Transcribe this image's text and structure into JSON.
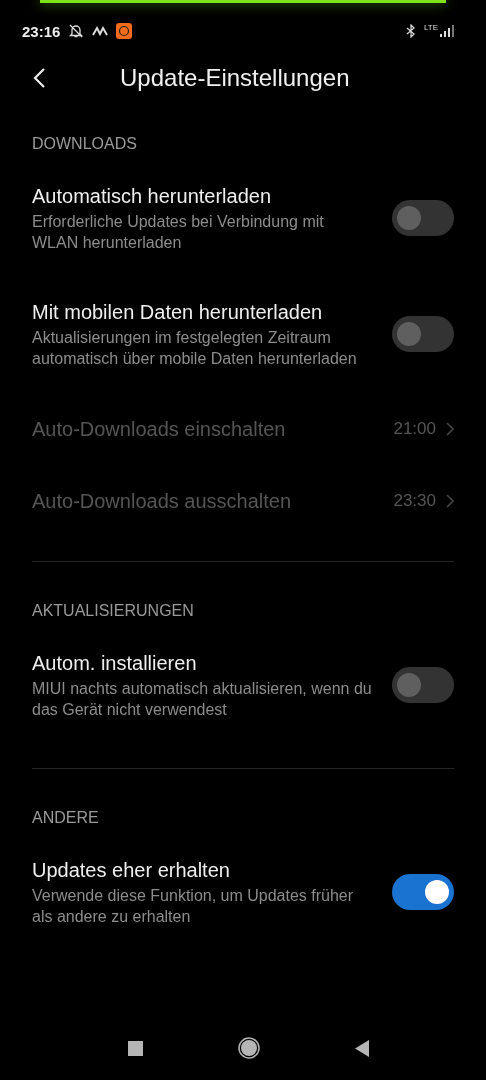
{
  "status_bar": {
    "time": "23:16",
    "network": "LTE"
  },
  "header": {
    "title": "Update-Einstellungen"
  },
  "sections": [
    {
      "title": "DOWNLOADS",
      "items": [
        {
          "kind": "toggle",
          "title": "Automatisch herunterladen",
          "subtitle": "Erforderliche Updates bei Verbindung mit WLAN herunterladen",
          "on": false
        },
        {
          "kind": "toggle",
          "title": "Mit mobilen Daten herunterladen",
          "subtitle": "Aktualisierungen im festgelegten Zeitraum automatisch über mobile Daten herunterladen",
          "on": false
        },
        {
          "kind": "time",
          "title": "Auto-Downloads einschalten",
          "value": "21:00",
          "disabled": true
        },
        {
          "kind": "time",
          "title": "Auto-Downloads ausschalten",
          "value": "23:30",
          "disabled": true
        }
      ]
    },
    {
      "title": "AKTUALISIERUNGEN",
      "items": [
        {
          "kind": "toggle",
          "title": "Autom. installieren",
          "subtitle": "MIUI nachts automatisch aktualisieren, wenn du das Gerät nicht verwendest",
          "on": false
        }
      ]
    },
    {
      "title": "ANDERE",
      "items": [
        {
          "kind": "toggle",
          "title": "Updates eher erhalten",
          "subtitle": "Verwende diese Funktion, um Updates früher als andere zu erhalten",
          "on": true
        }
      ]
    }
  ]
}
